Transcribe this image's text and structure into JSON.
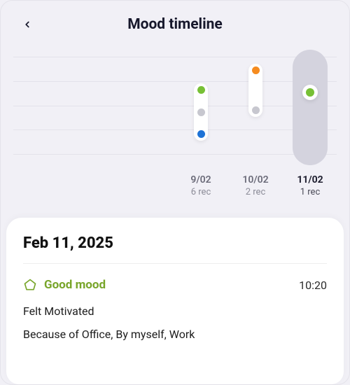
{
  "header": {
    "title": "Mood timeline"
  },
  "columns": [
    {
      "date": "9/02",
      "rec": "6 rec"
    },
    {
      "date": "10/02",
      "rec": "2 rec"
    },
    {
      "date": "11/02",
      "rec": "1 rec"
    }
  ],
  "colors": {
    "green": "#77c035",
    "grey": "#c7c7cf",
    "blue": "#1f73d6",
    "orange": "#f58b1f"
  },
  "detail": {
    "date": "Feb 11, 2025",
    "mood": "Good mood",
    "time": "10:20",
    "felt": "Felt Motivated",
    "because": "Because of Office, By myself, Work"
  },
  "chart_data": {
    "type": "scatter",
    "title": "Mood timeline",
    "xlabel": "",
    "ylabel": "",
    "categories": [
      "9/02",
      "10/02",
      "11/02"
    ],
    "record_counts": [
      6,
      2,
      1
    ],
    "ylim": [
      0,
      4
    ],
    "series": [
      {
        "name": "9/02",
        "points": [
          {
            "level": 3,
            "color": "green"
          },
          {
            "level": 2,
            "color": "grey"
          },
          {
            "level": 1,
            "color": "blue"
          }
        ]
      },
      {
        "name": "10/02",
        "points": [
          {
            "level": 4,
            "color": "orange"
          },
          {
            "level": 2,
            "color": "grey"
          }
        ]
      },
      {
        "name": "11/02",
        "points": [
          {
            "level": 3,
            "color": "green"
          }
        ],
        "selected": true
      }
    ]
  }
}
